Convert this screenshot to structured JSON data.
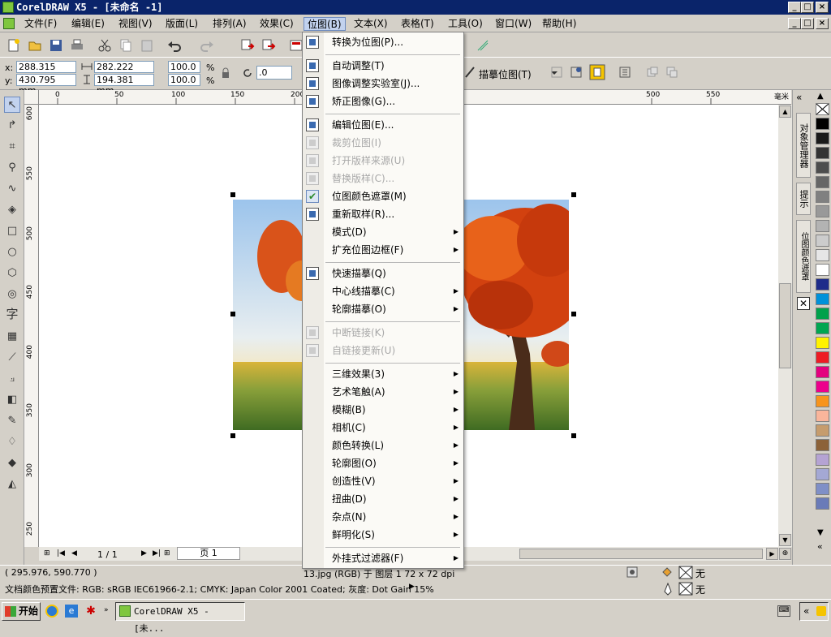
{
  "window": {
    "title": "CorelDRAW X5 - [未命名 -1]",
    "min_glyph": "_",
    "max_glyph": "□",
    "close_glyph": "×"
  },
  "menubar": [
    {
      "label": "文件(F)"
    },
    {
      "label": "编辑(E)"
    },
    {
      "label": "视图(V)"
    },
    {
      "label": "版面(L)"
    },
    {
      "label": "排列(A)"
    },
    {
      "label": "效果(C)"
    },
    {
      "label": "位图(B)",
      "active": true
    },
    {
      "label": "文本(X)"
    },
    {
      "label": "表格(T)"
    },
    {
      "label": "工具(O)"
    },
    {
      "label": "窗口(W)"
    },
    {
      "label": "帮助(H)"
    }
  ],
  "propbar": {
    "x_label": "x:",
    "y_label": "y:",
    "x_value": "288.315 mm",
    "y_value": "430.795 mm",
    "w_value": "282.222 mm",
    "h_value": "194.381 mm",
    "scale_x": "100.0",
    "scale_y": "100.0",
    "percent": "%",
    "rotation": ".0",
    "trace_label": "描摹位图(T)"
  },
  "bitmap_menu": {
    "items": [
      {
        "label": "转换为位图(P)...",
        "enabled": true,
        "icon": "convert-bitmap-icon"
      },
      {
        "sep": true
      },
      {
        "label": "自动调整(T)",
        "enabled": true,
        "icon": "auto-adjust-icon"
      },
      {
        "label": "图像调整实验室(J)...",
        "enabled": true,
        "icon": "image-lab-icon"
      },
      {
        "label": "矫正图像(G)...",
        "enabled": true,
        "icon": "straighten-icon"
      },
      {
        "sep": true
      },
      {
        "label": "编辑位图(E)...",
        "enabled": true,
        "icon": "edit-bitmap-icon"
      },
      {
        "label": "裁剪位图(I)",
        "enabled": false,
        "icon": "crop-bitmap-icon"
      },
      {
        "label": "打开版样来源(U)",
        "enabled": false,
        "icon": "open-source-icon"
      },
      {
        "label": "替换版样(C)...",
        "enabled": false,
        "icon": "replace-icon"
      },
      {
        "label": "位图颜色遮罩(M)",
        "enabled": true,
        "icon": "checkmark-icon"
      },
      {
        "label": "重新取样(R)...",
        "enabled": true,
        "icon": "resample-icon"
      },
      {
        "label": "模式(D)",
        "enabled": true,
        "submenu": true
      },
      {
        "label": "扩充位图边框(F)",
        "enabled": true,
        "submenu": true
      },
      {
        "sep": true
      },
      {
        "label": "快速描摹(Q)",
        "enabled": true,
        "icon": "quick-trace-icon"
      },
      {
        "label": "中心线描摹(C)",
        "enabled": true,
        "submenu": true
      },
      {
        "label": "轮廓描摹(O)",
        "enabled": true,
        "submenu": true
      },
      {
        "sep": true
      },
      {
        "label": "中断链接(K)",
        "enabled": false,
        "icon": "break-link-icon"
      },
      {
        "label": "自链接更新(U)",
        "enabled": false,
        "icon": "update-link-icon"
      },
      {
        "sep": true
      },
      {
        "label": "三维效果(3)",
        "enabled": true,
        "submenu": true
      },
      {
        "label": "艺术笔触(A)",
        "enabled": true,
        "submenu": true
      },
      {
        "label": "模糊(B)",
        "enabled": true,
        "submenu": true
      },
      {
        "label": "相机(C)",
        "enabled": true,
        "submenu": true
      },
      {
        "label": "颜色转换(L)",
        "enabled": true,
        "submenu": true
      },
      {
        "label": "轮廓图(O)",
        "enabled": true,
        "submenu": true
      },
      {
        "label": "创造性(V)",
        "enabled": true,
        "submenu": true
      },
      {
        "label": "扭曲(D)",
        "enabled": true,
        "submenu": true
      },
      {
        "label": "杂点(N)",
        "enabled": true,
        "submenu": true
      },
      {
        "label": "鲜明化(S)",
        "enabled": true,
        "submenu": true
      },
      {
        "sep": true
      },
      {
        "label": "外挂式过滤器(F)",
        "enabled": true,
        "submenu": true
      }
    ]
  },
  "rulers": {
    "h_ticks": [
      "0",
      "50",
      "100",
      "150",
      "200",
      "500",
      "550"
    ],
    "h_unit": "毫米",
    "v_ticks": [
      "600",
      "550",
      "500",
      "450",
      "400",
      "350",
      "300",
      "250"
    ]
  },
  "page_nav": {
    "count": "1 / 1",
    "tab": "页 1"
  },
  "dockers": {
    "object_manager": "对象管理器",
    "hints": "提示",
    "bitmap_color_mask": "位图颜色遮罩"
  },
  "palette_colors": [
    "#ffffff",
    "#000000",
    "#1a1a1a",
    "#333333",
    "#4d4d4d",
    "#666666",
    "#808080",
    "#999999",
    "#b3b3b3",
    "#cccccc",
    "#e6e6e6",
    "#ffffff",
    "#1e2c8a",
    "#0091d9",
    "#00a14b",
    "#00a651",
    "#fff200",
    "#ed1c24",
    "#e4007f",
    "#ec008c",
    "#f7941d",
    "#f9b59b",
    "#c69c6d",
    "#8c6239",
    "#b5a3d3",
    "#a4a8d4",
    "#7f8fc7",
    "#6a7bb8"
  ],
  "status": {
    "coords": "( 295.976, 590.770 )",
    "object_info": "13.jpg (RGB) 于 图层 1 72 x 72 dpi",
    "fill_none": "无",
    "outline_none": "无",
    "color_profile": "文档颜色预置文件: RGB: sRGB IEC61966-2.1; CMYK: Japan Color 2001 Coated; 灰度: Dot Gain 15%"
  },
  "taskbar": {
    "start": "开始",
    "task": "CorelDRAW X5 - [未..."
  }
}
